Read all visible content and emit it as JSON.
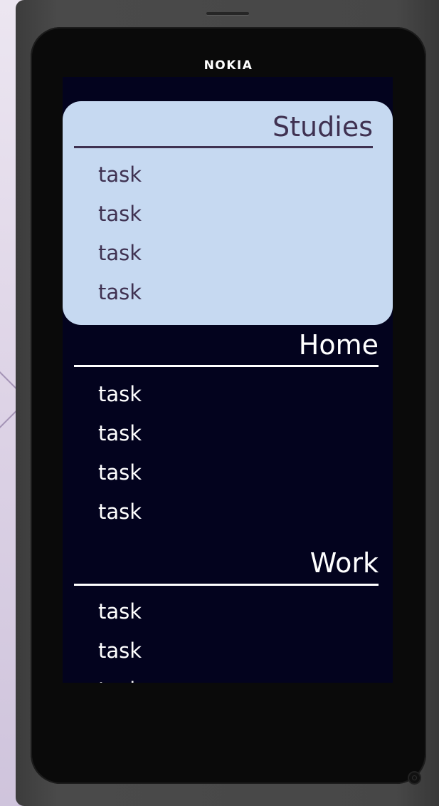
{
  "device": {
    "brand": "NOKIA"
  },
  "sections": [
    {
      "title": "Studies",
      "selected": true,
      "tasks": [
        "task",
        "task",
        "task",
        "task"
      ]
    },
    {
      "title": "Home",
      "selected": false,
      "tasks": [
        "task",
        "task",
        "task",
        "task"
      ]
    },
    {
      "title": "Work",
      "selected": false,
      "tasks": [
        "task",
        "task",
        "task"
      ]
    }
  ],
  "colors": {
    "screen_background": "#03031e",
    "selected_section_background": "#c6d9f1",
    "selected_section_text": "#3f3151",
    "section_text": "#ffffff",
    "phone_body": "#474747"
  }
}
